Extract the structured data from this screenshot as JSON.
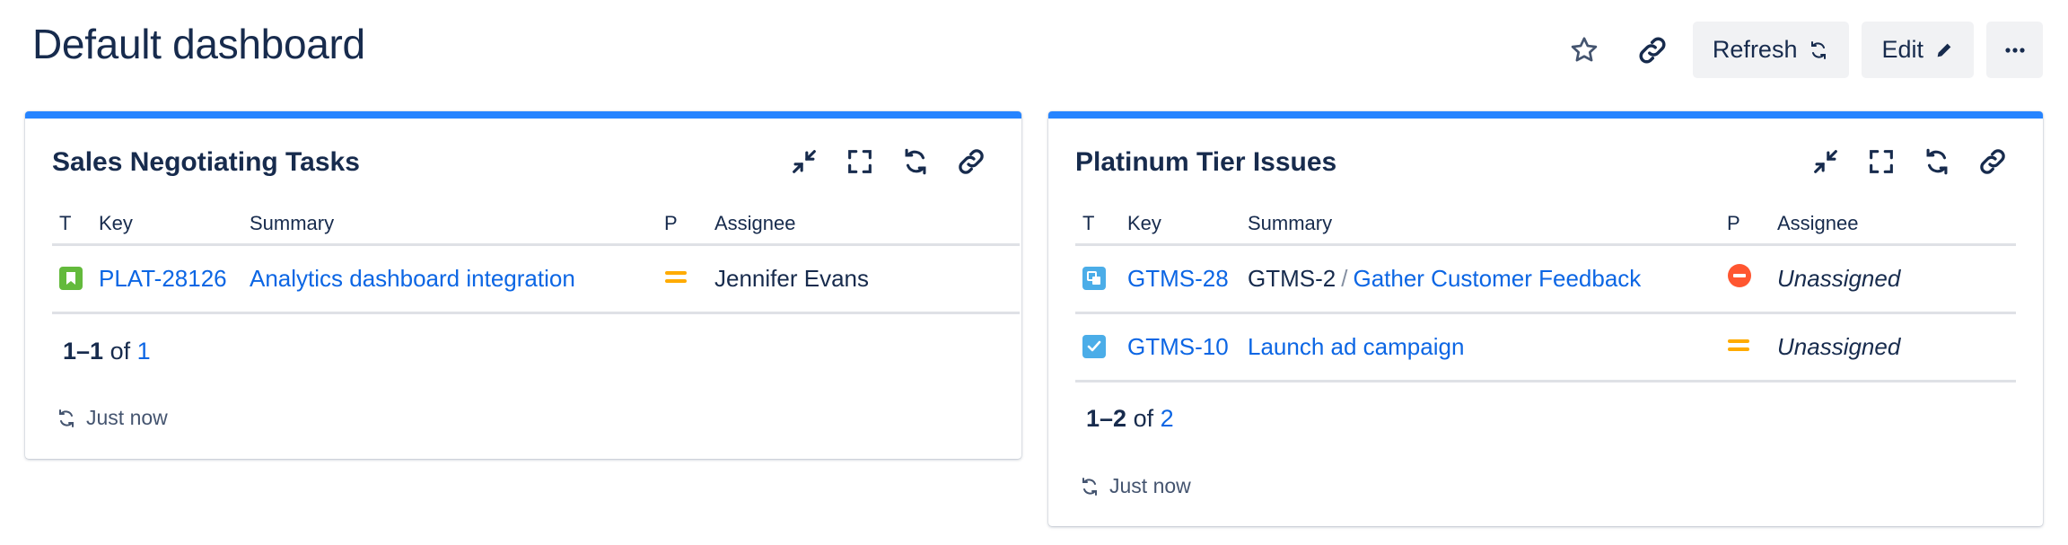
{
  "page": {
    "title": "Default dashboard",
    "refresh_label": "Refresh",
    "edit_label": "Edit"
  },
  "gadgets": [
    {
      "title": "Sales Negotiating Tasks",
      "columns": [
        "T",
        "Key",
        "Summary",
        "P",
        "Assignee"
      ],
      "rows": [
        {
          "type_icon": "story-icon",
          "key": "PLAT-28126",
          "summary": "Analytics dashboard integration",
          "priority_icon": "priority-medium-icon",
          "assignee": "Jennifer Evans"
        }
      ],
      "pager": {
        "range": "1–1",
        "of": "of",
        "total": "1"
      },
      "updated": "Just now"
    },
    {
      "title": "Platinum Tier Issues",
      "columns": [
        "T",
        "Key",
        "Summary",
        "P",
        "Assignee"
      ],
      "rows": [
        {
          "type_icon": "subtask-icon",
          "key": "GTMS-28",
          "parent": "GTMS-2",
          "separator": "/",
          "summary": "Gather Customer Feedback",
          "priority_icon": "priority-blocker-icon",
          "assignee": "Unassigned"
        },
        {
          "type_icon": "task-icon",
          "key": "GTMS-10",
          "summary": "Launch ad campaign",
          "priority_icon": "priority-medium-icon",
          "assignee": "Unassigned"
        }
      ],
      "pager": {
        "range": "1–2",
        "of": "of",
        "total": "2"
      },
      "updated": "Just now"
    }
  ],
  "colors": {
    "accent": "#2684ff",
    "link": "#0c66e4",
    "text": "#172b4d",
    "story": "#63ba3c",
    "task": "#4bade8",
    "priority_medium": "#ffab00",
    "priority_blocker": "#ff5630"
  }
}
